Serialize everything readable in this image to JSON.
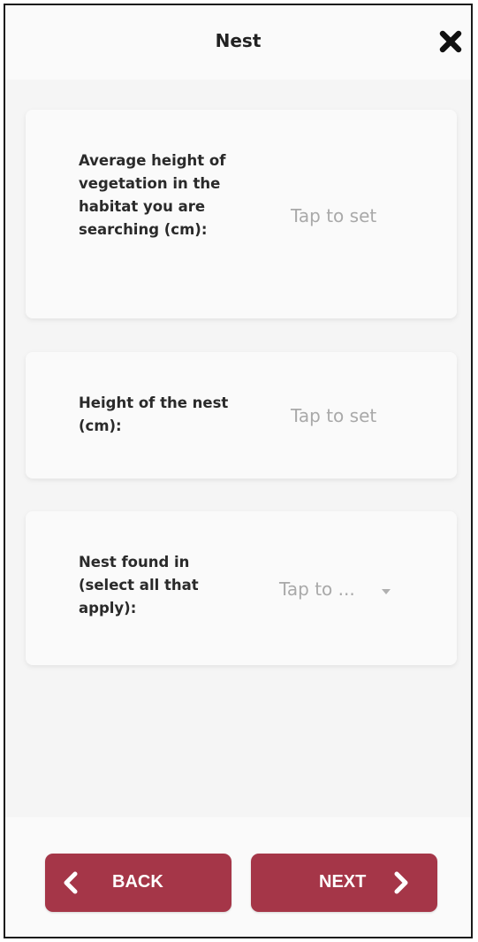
{
  "header": {
    "title": "Nest",
    "close_icon": "close-x-icon"
  },
  "fields": [
    {
      "label": "Average height of vegetation in the habitat you are searching (cm):",
      "value": "Tap to set"
    },
    {
      "label": "Height of the nest (cm):",
      "value": "Tap to set"
    },
    {
      "label": "Nest found in (select all that apply):",
      "value": "Tap to ...",
      "control": "dropdown"
    }
  ],
  "footer": {
    "back_label": "BACK",
    "next_label": "NEXT",
    "button_color": "#a53648"
  }
}
